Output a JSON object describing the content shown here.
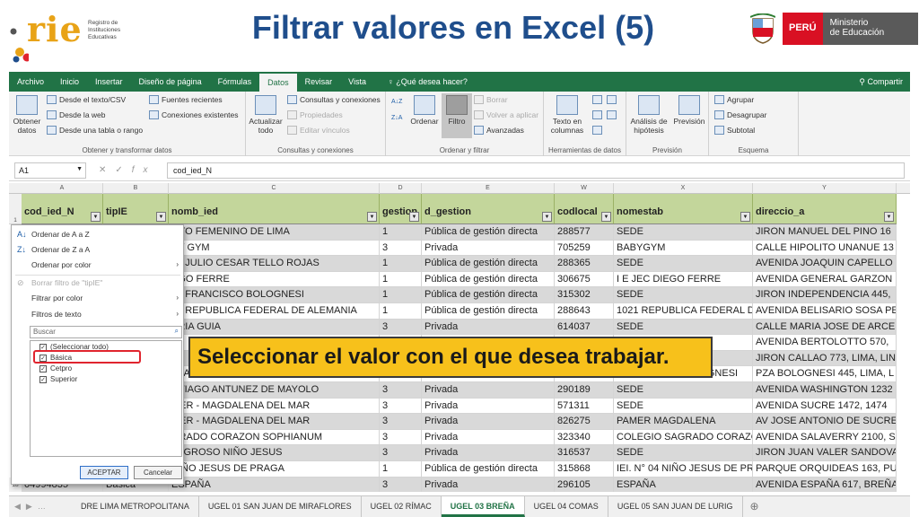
{
  "slide": {
    "title": "Filtrar valores en Excel (5)",
    "logo_text": "rie",
    "logo_sub": [
      "Registro de",
      "Instituciones",
      "Educativas"
    ],
    "peru_label": "PERÚ",
    "ministry_label": [
      "Ministerio",
      "de Educación"
    ]
  },
  "colors": {
    "excel_green": "#217346",
    "header_fill": "#c3d69b",
    "callout": "#f7c11b",
    "title_blue": "#1f4e8c",
    "highlight_red": "#e0242e"
  },
  "ribbon_tabs": [
    "Archivo",
    "Inicio",
    "Insertar",
    "Diseño de página",
    "Fórmulas",
    "Datos",
    "Revisar",
    "Vista"
  ],
  "active_tab": "Datos",
  "tell_me": "¿Qué desea hacer?",
  "share": "Compartir",
  "ribbon": {
    "obtener": {
      "big": "Obtener datos",
      "items": [
        "Desde el texto/CSV",
        "Desde la web",
        "Desde una tabla o rango"
      ],
      "label": "Obtener y transformar datos",
      "items2": [
        "Fuentes recientes",
        "Conexiones existentes"
      ]
    },
    "consultas": {
      "big": "Actualizar todo",
      "items": [
        "Consultas y conexiones",
        "Propiedades",
        "Editar vínculos"
      ],
      "label": "Consultas y conexiones"
    },
    "ordenar": {
      "ordenar": "Ordenar",
      "filtro": "Filtro",
      "items": [
        "Borrar",
        "Volver a aplicar",
        "Avanzadas"
      ],
      "label": "Ordenar y filtrar"
    },
    "herr": {
      "texto": "Texto en columnas",
      "label": "Herramientas de datos"
    },
    "prevision": {
      "analisis": "Análisis de hipótesis",
      "prev": "Previsión",
      "label": "Previsión"
    },
    "esquema": {
      "items": [
        "Agrupar",
        "Desagrupar",
        "Subtotal"
      ],
      "label": "Esquema"
    }
  },
  "formula_bar": {
    "cell_ref": "A1",
    "fx": "fx",
    "content": "cod_ied_N"
  },
  "columns": [
    {
      "letter": "A",
      "header": "cod_ied_N"
    },
    {
      "letter": "B",
      "header": "tipIE"
    },
    {
      "letter": "C",
      "header": "nomb_ied"
    },
    {
      "letter": "D",
      "header": "gestion"
    },
    {
      "letter": "E",
      "header": "d_gestion"
    },
    {
      "letter": "W",
      "header": "codlocal"
    },
    {
      "letter": "X",
      "header": "nomestab"
    },
    {
      "letter": "Y",
      "header": "direccio_a"
    }
  ],
  "rows": [
    {
      "c": "OTO FEMENINO DE LIMA",
      "d": "1",
      "e": "Pública de gestión directa",
      "w": "288577",
      "x": "SEDE",
      "y": "JIRON MANUEL DEL PINO 16"
    },
    {
      "c": "BY GYM",
      "d": "3",
      "e": "Privada",
      "w": "705259",
      "x": "BABYGYM",
      "y": "CALLE HIPOLITO UNANUE 13"
    },
    {
      "c": "57 JULIO CESAR TELLO ROJAS",
      "d": "1",
      "e": "Pública de gestión directa",
      "w": "288365",
      "x": "SEDE",
      "y": "AVENIDA JOAQUIN CAPELLO"
    },
    {
      "c": "EGO FERRE",
      "d": "1",
      "e": "Pública de gestión directa",
      "w": "306675",
      "x": "I E JEC DIEGO FERRE",
      "y": "AVENIDA GENERAL GARZON"
    },
    {
      "c": "38 FRANCISCO BOLOGNESI",
      "d": "1",
      "e": "Pública de gestión directa",
      "w": "315302",
      "x": "SEDE",
      "y": "JIRON INDEPENDENCIA 445,"
    },
    {
      "c": "21 REPUBLICA FEDERAL DE ALEMANIA",
      "d": "1",
      "e": "Pública de gestión directa",
      "w": "288643",
      "x": "1021 REPUBLICA FEDERAL D",
      "y": "AVENIDA BELISARIO SOSA PE"
    },
    {
      "c": "ARIA GUIA",
      "d": "3",
      "e": "Privada",
      "w": "614037",
      "x": "SEDE",
      "y": "CALLE MARIA JOSE DE ARCE"
    },
    {
      "c": "",
      "d": "",
      "e": "",
      "w": "",
      "x": "",
      "y": "AVENIDA BERTOLOTTO 570,"
    },
    {
      "c": "",
      "d": "",
      "e": "",
      "w": "",
      "x": "VENEZU",
      "y": "JIRON CALLAO 773, LIMA, LIN"
    },
    {
      "c": "NJAMIN GALLEGO MATTOS",
      "d": "3",
      "e": "Privada",
      "w": "290108",
      "x": "SEDE PLAZA BOLOGNESI",
      "y": "PZA BOLOGNESI 445, LIMA, L"
    },
    {
      "c": "NTIAGO ANTUNEZ DE MAYOLO",
      "d": "3",
      "e": "Privada",
      "w": "290189",
      "x": "SEDE",
      "y": "AVENIDA WASHINGTON 1232"
    },
    {
      "c": "MER - MAGDALENA DEL MAR",
      "d": "3",
      "e": "Privada",
      "w": "571311",
      "x": "SEDE",
      "y": "AVENIDA SUCRE 1472, 1474"
    },
    {
      "c": "MER - MAGDALENA DEL MAR",
      "d": "3",
      "e": "Privada",
      "w": "826275",
      "x": "PAMER MAGDALENA",
      "y": "AV JOSE ANTONIO DE SUCRE"
    },
    {
      "c": "GRADO CORAZON SOPHIANUM",
      "d": "3",
      "e": "Privada",
      "w": "323340",
      "x": "COLEGIO SAGRADO CORAZÓ",
      "y": "AVENIDA SALAVERRY 2100, S"
    },
    {
      "c": "LAGROSO NIÑO JESUS",
      "d": "3",
      "e": "Privada",
      "w": "316537",
      "x": "SEDE",
      "y": "JIRON JUAN VALER SANDOVA"
    },
    {
      "c": "NIÑO JESUS DE PRAGA",
      "d": "1",
      "e": "Pública de gestión directa",
      "w": "315868",
      "x": "IEI. N° 04 NIÑO JESUS DE PR",
      "y": "PARQUE ORQUIDEAS 163, PU"
    },
    {
      "a": "04994835",
      "b": "Básica",
      "c": "ESPAÑA",
      "d": "3",
      "e": "Privada",
      "w": "296105",
      "x": "ESPAÑA",
      "y": "AVENIDA ESPAÑA 617, BREÑA"
    }
  ],
  "row_numbers": [
    "1",
    "18"
  ],
  "dropdown": {
    "menu": [
      "Ordenar de A a Z",
      "Ordenar de Z a A",
      "Ordenar por color",
      "Borrar filtro de \"tipIE\"",
      "Filtrar por color",
      "Filtros de texto"
    ],
    "search_placeholder": "Buscar",
    "options": [
      "(Seleccionar todo)",
      "Básica",
      "Cetpro",
      "Superior"
    ],
    "accept": "ACEPTAR",
    "cancel": "Cancelar"
  },
  "callout": "Seleccionar el valor con el que desea trabajar.",
  "sheet_tabs": [
    "DRE LIMA METROPOLITANA",
    "UGEL 01 SAN JUAN DE MIRAFLORES",
    "UGEL 02 RÍMAC",
    "UGEL 03 BREÑA",
    "UGEL 04 COMAS",
    "UGEL 05 SAN JUAN DE LURIG"
  ],
  "active_sheet": "UGEL 03 BREÑA"
}
